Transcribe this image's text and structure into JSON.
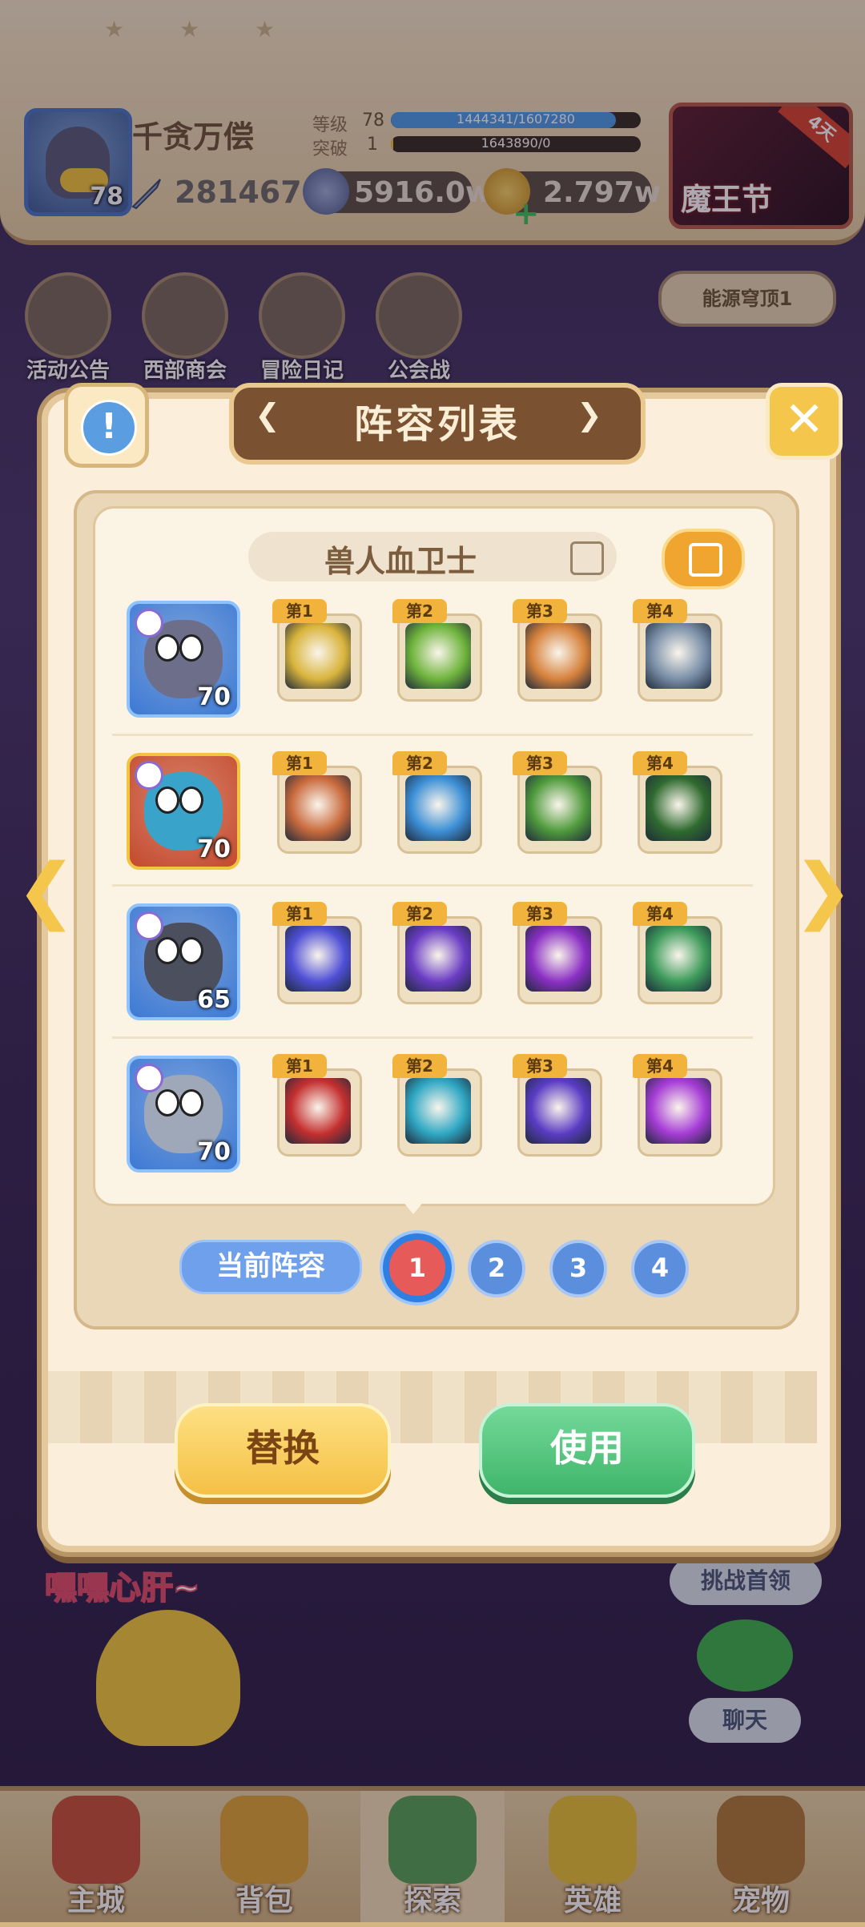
{
  "player": {
    "name": "千贪万偿",
    "level": "78",
    "power": "281467",
    "rank_label": "等级",
    "rank_value": "78",
    "rank_exp": "1444341/1607280",
    "rank_fill": 0.9,
    "break_label": "突破",
    "break_value": "1",
    "break_exp": "1643890/0",
    "break_fill": 0.0,
    "gold": "5916.0w",
    "gems": "2.797w"
  },
  "event": {
    "label": "魔王节",
    "tag": "4天"
  },
  "bg_menu": [
    {
      "label": "活动公告"
    },
    {
      "label": "西部商会"
    },
    {
      "label": "冒险日记"
    },
    {
      "label": "公会战"
    }
  ],
  "energy_dome": "能源穹顶1",
  "dialog": {
    "title": "阵容列表",
    "formation_name": "兽人血卫士",
    "current_label": "当前阵容",
    "pages": [
      "1",
      "2",
      "3",
      "4"
    ],
    "active_page": 0,
    "replace_label": "替换",
    "use_label": "使用",
    "heroes": [
      {
        "level": "70",
        "card_color": "#3c79d4",
        "skills": [
          {
            "tag": "第1",
            "art": "#d9b43c"
          },
          {
            "tag": "第2",
            "art": "#6fb43c"
          },
          {
            "tag": "第3",
            "art": "#d6823c"
          },
          {
            "tag": "第4",
            "art": "#7a8fa8"
          }
        ]
      },
      {
        "level": "70",
        "card_color": "#c44a2e",
        "skills": [
          {
            "tag": "第1",
            "art": "#c96a3c"
          },
          {
            "tag": "第2",
            "art": "#3c8fd6"
          },
          {
            "tag": "第3",
            "art": "#4f9a3c"
          },
          {
            "tag": "第4",
            "art": "#2f6a2f"
          }
        ]
      },
      {
        "level": "65",
        "card_color": "#3c79d4",
        "skills": [
          {
            "tag": "第1",
            "art": "#4f4fd6"
          },
          {
            "tag": "第2",
            "art": "#6a3cc4"
          },
          {
            "tag": "第3",
            "art": "#8a2fc4"
          },
          {
            "tag": "第4",
            "art": "#3c9a5a"
          }
        ]
      },
      {
        "level": "70",
        "card_color": "#3c79d4",
        "skills": [
          {
            "tag": "第1",
            "art": "#c42f2f"
          },
          {
            "tag": "第2",
            "art": "#2fa8c4"
          },
          {
            "tag": "第3",
            "art": "#5a3cc4"
          },
          {
            "tag": "第4",
            "art": "#a63cd6"
          }
        ]
      }
    ]
  },
  "scene": {
    "hey_text": "嘿嘿心肝~",
    "challenge_label": "挑战首领",
    "chat_label": "聊天"
  },
  "bottom_nav": [
    {
      "label": "主城"
    },
    {
      "label": "背包"
    },
    {
      "label": "探索"
    },
    {
      "label": "英雄"
    },
    {
      "label": "宠物"
    }
  ],
  "colors": {
    "accent_gold": "#f5c64c",
    "accent_green": "#3fb56a",
    "accent_blue": "#5b8fde",
    "title_brown": "#7a5232"
  }
}
